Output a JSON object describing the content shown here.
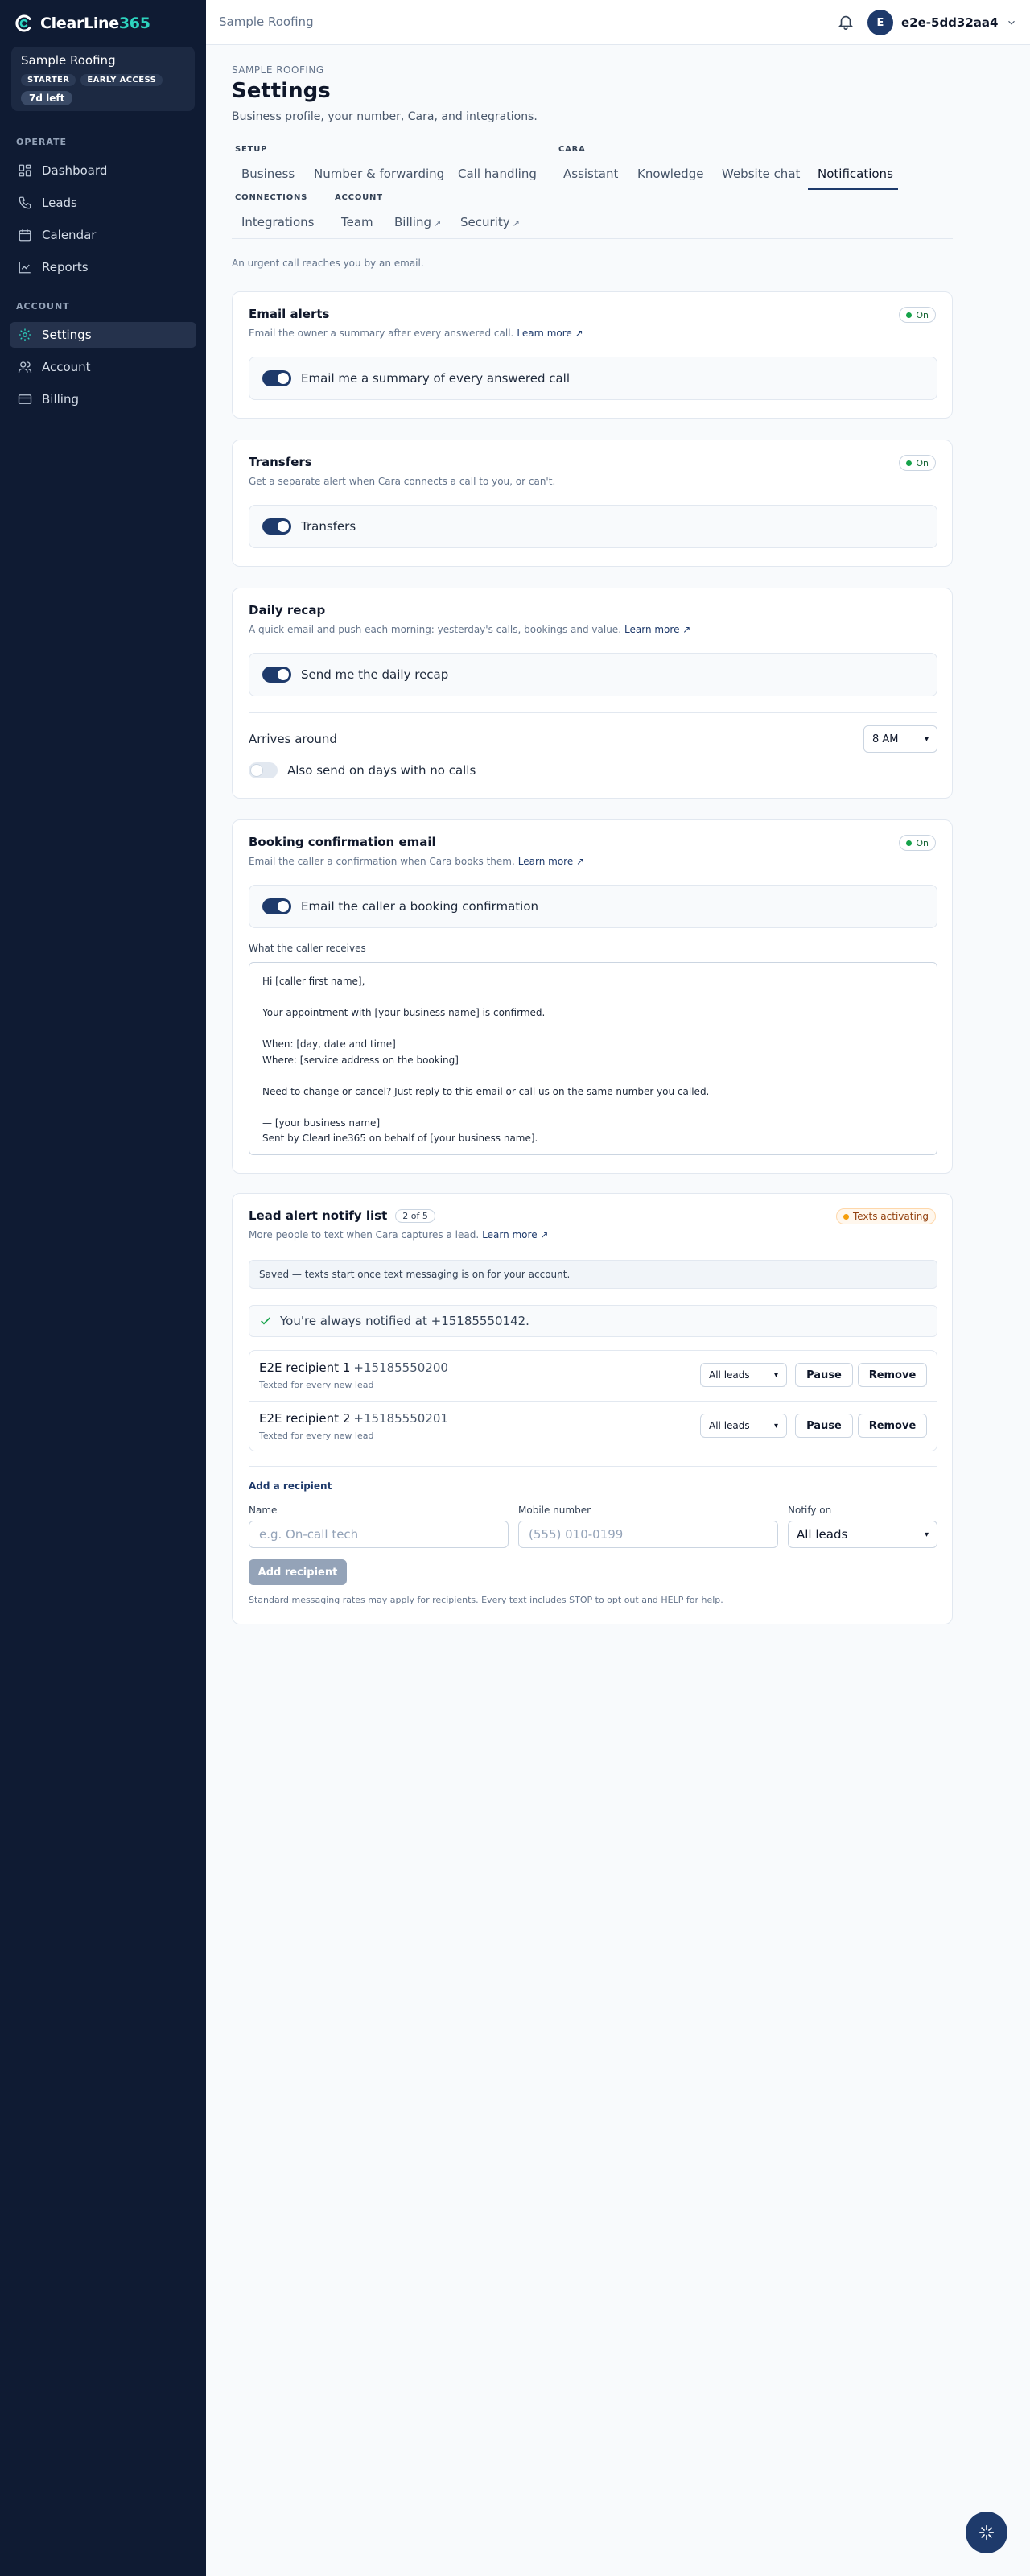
{
  "brand": {
    "name_main": "ClearLine",
    "name_accent": "365"
  },
  "org": {
    "name": "Sample Roofing",
    "badges": [
      "STARTER",
      "EARLY ACCESS"
    ],
    "trial": "7d left"
  },
  "nav": {
    "operate_label": "OPERATE",
    "operate": [
      {
        "label": "Dashboard",
        "icon": "dashboard-icon"
      },
      {
        "label": "Leads",
        "icon": "phone-icon"
      },
      {
        "label": "Calendar",
        "icon": "calendar-icon"
      },
      {
        "label": "Reports",
        "icon": "chart-icon"
      }
    ],
    "account_label": "ACCOUNT",
    "account": [
      {
        "label": "Settings",
        "icon": "gear-icon",
        "active": true
      },
      {
        "label": "Account",
        "icon": "users-icon"
      },
      {
        "label": "Billing",
        "icon": "card-icon"
      }
    ]
  },
  "topbar": {
    "breadcrumb": "Sample Roofing",
    "avatar_initial": "E",
    "user": "e2e-5dd32aa4"
  },
  "header": {
    "eyebrow": "SAMPLE ROOFING",
    "title": "Settings",
    "subtitle": "Business profile, your number, Cara, and integrations."
  },
  "tabs": {
    "setup_label": "SETUP",
    "cara_label": "CARA",
    "connections_label": "CONNECTIONS",
    "account_label": "ACCOUNT",
    "business": "Business",
    "number": "Number & forwarding",
    "call_handling": "Call handling",
    "assistant": "Assistant",
    "knowledge": "Knowledge",
    "website_chat": "Website chat",
    "notifications": "Notifications",
    "integrations": "Integrations",
    "team": "Team",
    "billing": "Billing",
    "security": "Security",
    "ext_glyph": "↗"
  },
  "intro": "An urgent call reaches you by an email.",
  "learn_more": "Learn more ↗",
  "on_label": "On",
  "email_alerts": {
    "title": "Email alerts",
    "desc": "Email the owner a summary after every answered call.",
    "toggle": "Email me a summary of every answered call"
  },
  "transfers": {
    "title": "Transfers",
    "desc": "Get a separate alert when Cara connects a call to you, or can't.",
    "toggle": "Transfers"
  },
  "daily_recap": {
    "title": "Daily recap",
    "desc": "A quick email and push each morning: yesterday's calls, bookings and value.",
    "toggle": "Send me the daily recap",
    "arrives_label": "Arrives around",
    "arrives_value": "8 AM",
    "no_calls": "Also send on days with no calls"
  },
  "booking": {
    "title": "Booking confirmation email",
    "desc": "Email the caller a confirmation when Cara books them.",
    "toggle": "Email the caller a booking confirmation",
    "receives_label": "What the caller receives",
    "template": "Hi [caller first name],\n\nYour appointment with [your business name] is confirmed.\n\nWhen: [day, date and time]\nWhere: [service address on the booking]\n\nNeed to change or cancel? Just reply to this email or call us on the same number you called.\n\n— [your business name]\nSent by ClearLine365 on behalf of [your business name]."
  },
  "lead_alerts": {
    "title": "Lead alert notify list",
    "count": "2 of 5",
    "status": "Texts activating",
    "desc": "More people to text when Cara captures a lead.",
    "notice": "Saved — texts start once text messaging is on for your account.",
    "always": "You're always notified at +15185550142.",
    "recipients": [
      {
        "name": "E2E recipient 1",
        "phone": "+15185550200",
        "sub": "Texted for every new lead",
        "notify": "All leads"
      },
      {
        "name": "E2E recipient 2",
        "phone": "+15185550201",
        "sub": "Texted for every new lead",
        "notify": "All leads"
      }
    ],
    "pause": "Pause",
    "remove": "Remove",
    "add_title": "Add a recipient",
    "name_label": "Name",
    "name_placeholder": "e.g. On-call tech",
    "mobile_label": "Mobile number",
    "mobile_placeholder": "(555) 010-0199",
    "notify_label": "Notify on",
    "notify_value": "All leads",
    "add_button": "Add recipient",
    "footnote": "Standard messaging rates may apply for recipients. Every text includes STOP to opt out and HELP for help."
  },
  "colors": {
    "sidebar": "#0f1b33",
    "accent": "#2dd4bf",
    "primary": "#1e3a6b",
    "success": "#16a34a",
    "warning": "#f59e0b"
  }
}
